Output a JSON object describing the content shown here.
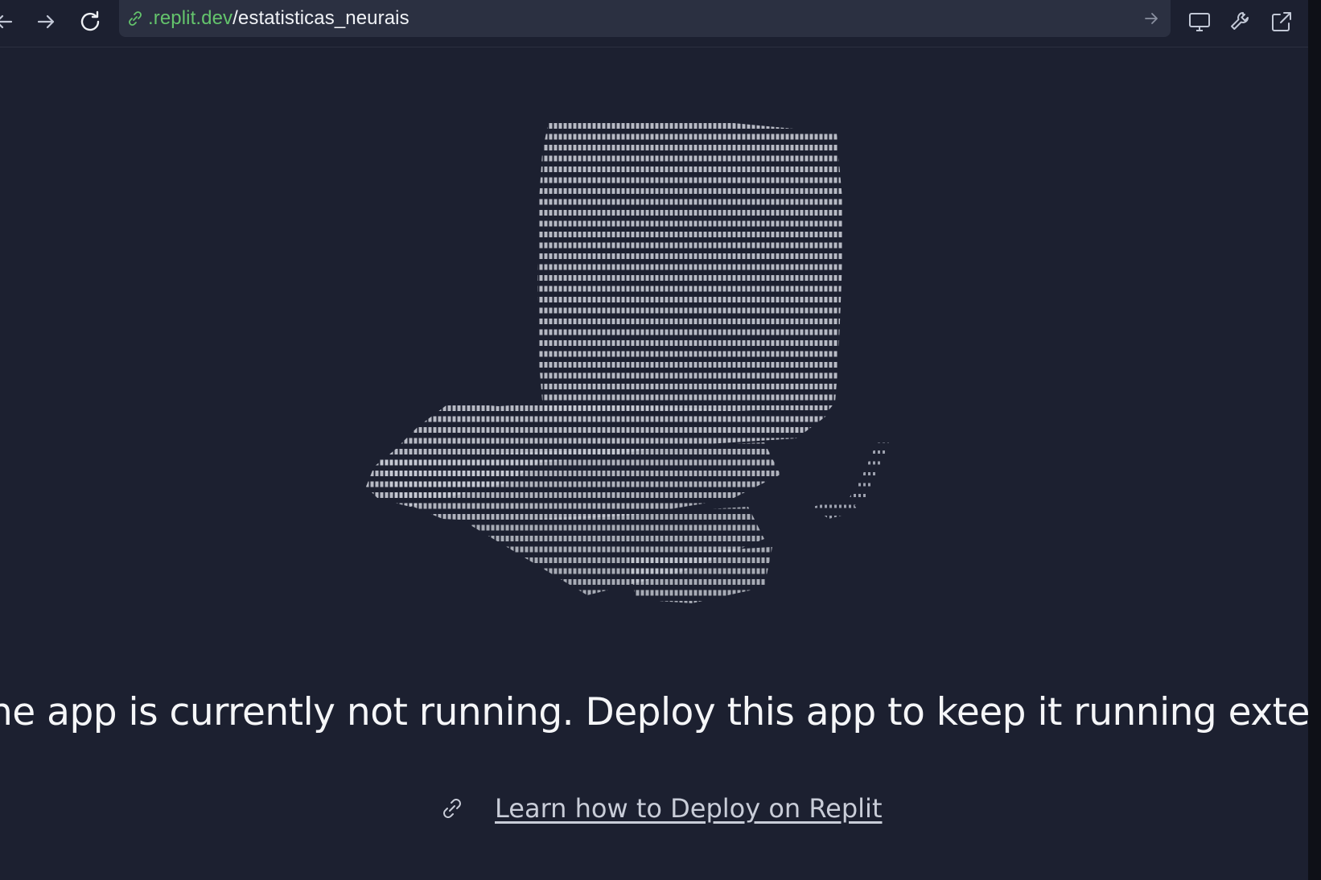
{
  "toolbar": {
    "back_icon": "arrow-left-icon",
    "forward_icon": "arrow-right-icon",
    "reload_icon": "reload-icon",
    "url_host": ".replit.dev",
    "url_path": "/estatisticas_neurais",
    "go_icon": "arrow-right-icon",
    "devices_icon": "monitor-icon",
    "devtools_icon": "wrench-icon",
    "open_external_icon": "external-link-icon"
  },
  "main": {
    "art": "ascii-art-cup-illustration",
    "message": "he app is currently not running. Deploy this app to keep it running externally.",
    "learn_link": "Learn how to Deploy on Replit",
    "link_icon": "link-icon"
  },
  "colors": {
    "background": "#1c2030",
    "url_bar": "#2b3041",
    "url_host": "#64c46c",
    "text": "#f5f6f8",
    "link": "#c9cdd8"
  }
}
